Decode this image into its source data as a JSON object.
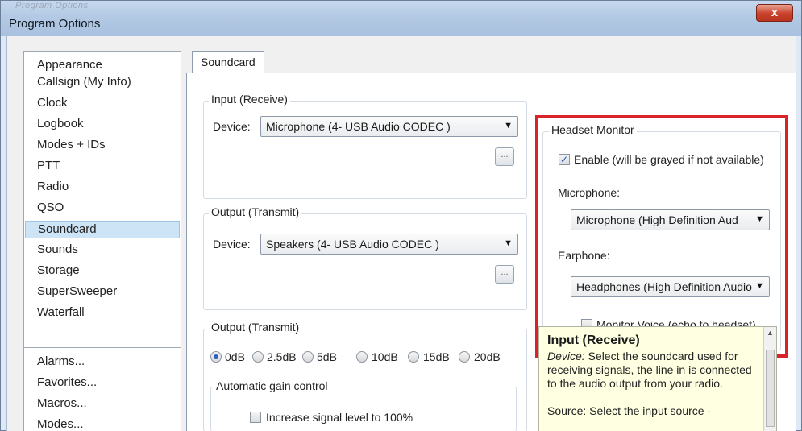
{
  "window": {
    "ghost_title": "Program Options",
    "title": "Program Options",
    "close_label": "x"
  },
  "nav": {
    "items": [
      "Appearance",
      "Callsign (My Info)",
      "Clock",
      "Logbook",
      "Modes + IDs",
      "PTT",
      "Radio",
      "QSO",
      "Soundcard",
      "Sounds",
      "Storage",
      "SuperSweeper",
      "Waterfall"
    ],
    "selected": "Soundcard",
    "items2": [
      "Alarms...",
      "Favorites...",
      "Macros...",
      "Modes..."
    ]
  },
  "tab": {
    "label": "Soundcard"
  },
  "input_group": {
    "title": "Input (Receive)",
    "device_label": "Device:",
    "device_value": "Microphone (4- USB Audio CODEC )",
    "browse": "..."
  },
  "output_group": {
    "title": "Output (Transmit)",
    "device_label": "Device:",
    "device_value": "Speakers (4- USB Audio CODEC )",
    "browse": "..."
  },
  "output_level": {
    "title": "Output (Transmit)",
    "options": [
      "0dB",
      "2.5dB",
      "5dB",
      "10dB",
      "15dB",
      "20dB"
    ],
    "selected": "0dB"
  },
  "agc": {
    "title": "Automatic gain control",
    "checkbox_label": "Increase signal level to 100%",
    "checked": false
  },
  "headset": {
    "title": "Headset Monitor",
    "enable_label": "Enable  (will be grayed if not available)",
    "enable_checked": true,
    "microphone_label": "Microphone:",
    "microphone_value": "Microphone (High Definition Aud",
    "earphone_label": "Earphone:",
    "earphone_value": "Headphones (High Definition Audio",
    "monitor_label": "Monitor Voice (echo to headset)",
    "monitor_checked": false
  },
  "help": {
    "heading": "Input (Receive)",
    "device_term": "Device:",
    "device_text": " Select the soundcard used for receiving signals, the line in is connected to the audio output from your radio.",
    "source_text": "Source: Select the input source -"
  },
  "colors": {
    "highlight_box": "#d9232b",
    "selection": "#cde4f7",
    "help_bg": "#ffffe1"
  }
}
